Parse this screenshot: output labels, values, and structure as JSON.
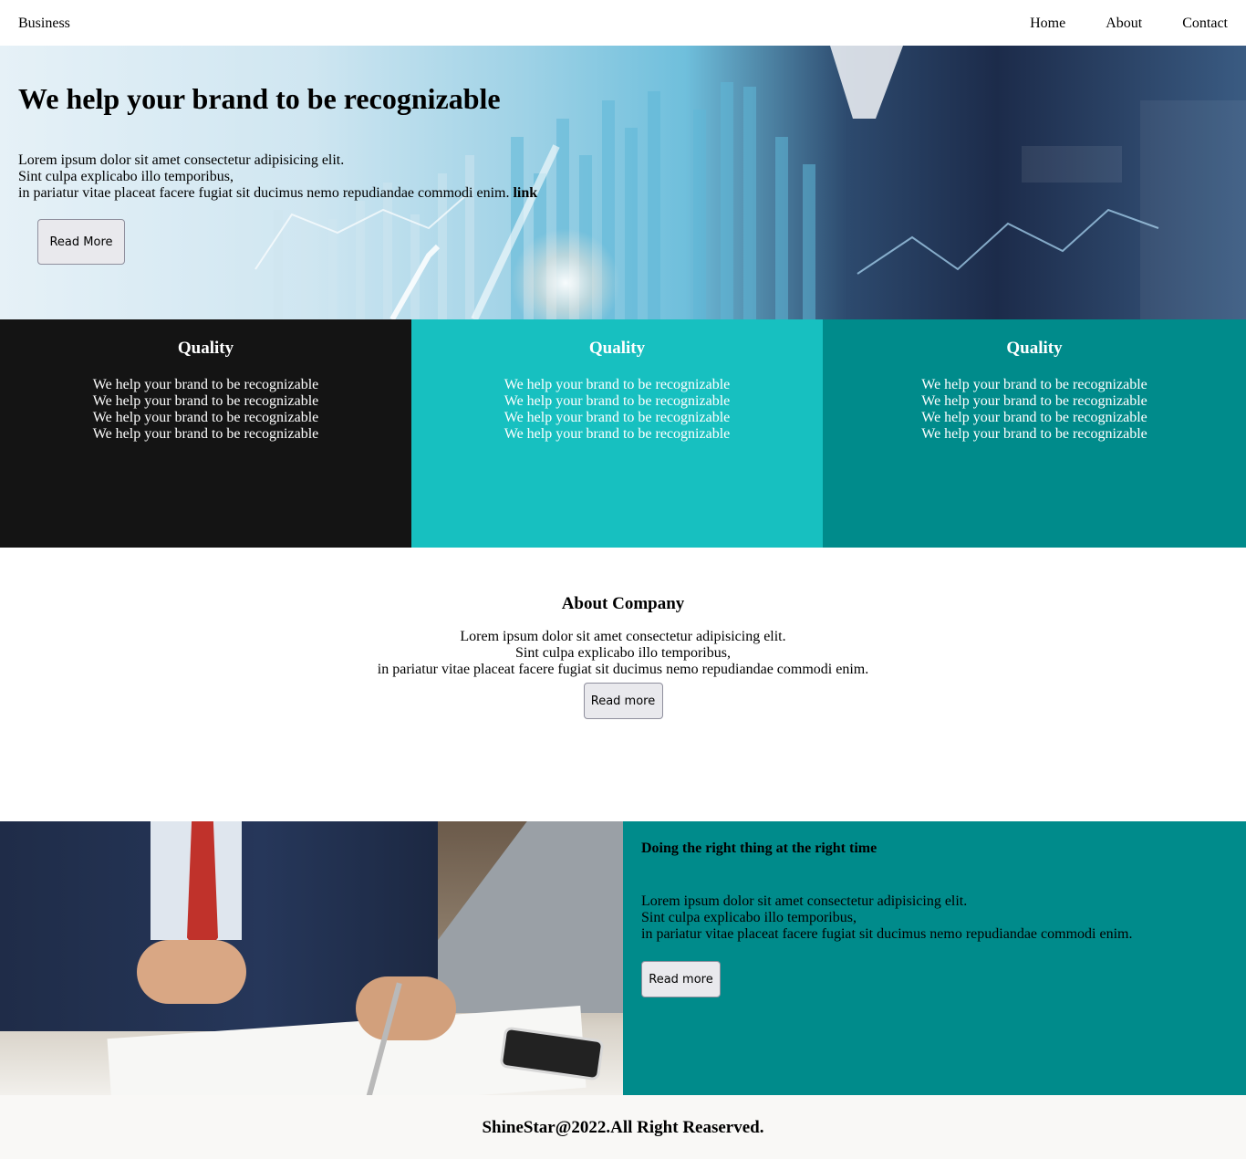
{
  "nav": {
    "brand": "Business",
    "links": [
      {
        "label": "Home"
      },
      {
        "label": "About"
      },
      {
        "label": "Contact"
      }
    ]
  },
  "hero": {
    "title": "We help your brand to be recognizable",
    "lines": [
      "Lorem ipsum dolor sit amet consectetur adipisicing elit.",
      "Sint culpa explicabo illo temporibus,",
      "in pariatur vitae placeat facere fugiat sit ducimus nemo repudiandae commodi enim."
    ],
    "link": "link",
    "button": "Read More"
  },
  "features": [
    {
      "title": "Quality",
      "lines": [
        "We help your brand to be recognizable",
        "We help your brand to be recognizable",
        "We help your brand to be recognizable",
        "We help your brand to be recognizable"
      ]
    },
    {
      "title": "Quality",
      "lines": [
        "We help your brand to be recognizable",
        "We help your brand to be recognizable",
        "We help your brand to be recognizable",
        "We help your brand to be recognizable"
      ]
    },
    {
      "title": "Quality",
      "lines": [
        "We help your brand to be recognizable",
        "We help your brand to be recognizable",
        "We help your brand to be recognizable",
        "We help your brand to be recognizable"
      ]
    }
  ],
  "about": {
    "title": "About Company",
    "lines": [
      "Lorem ipsum dolor sit amet consectetur adipisicing elit.",
      "Sint culpa explicabo illo temporibus,",
      "in pariatur vitae placeat facere fugiat sit ducimus nemo repudiandae commodi enim."
    ],
    "button": "Read more"
  },
  "split": {
    "title": "Doing the right thing at the right time",
    "lines": [
      "Lorem ipsum dolor sit amet consectetur adipisicing elit.",
      "Sint culpa explicabo illo temporibus,",
      "in pariatur vitae placeat facere fugiat sit ducimus nemo repudiandae commodi enim."
    ],
    "button": "Read more"
  },
  "footer": {
    "text": "ShineStar@2022.All Right Reaserved."
  },
  "colors": {
    "feature_dark": "#141414",
    "feature_cyan": "#17c0c0",
    "feature_teal": "#008b8b",
    "footer_bg": "#f9f8f6"
  }
}
